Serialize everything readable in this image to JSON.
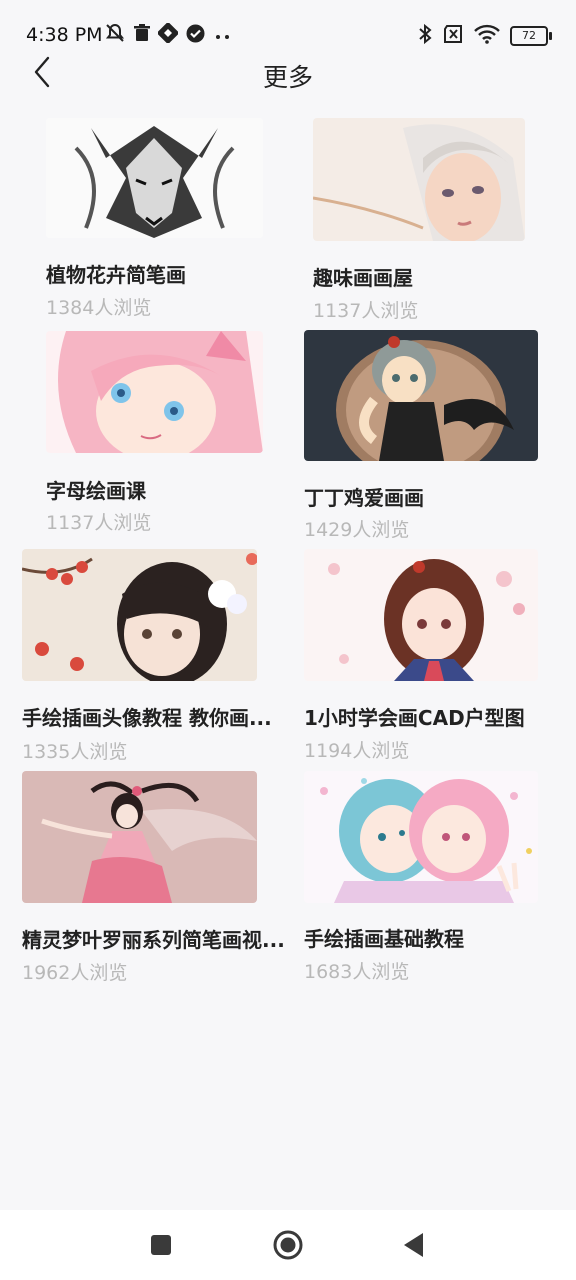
{
  "status_bar": {
    "time": "4:38 PM",
    "battery": "72",
    "left_icons": [
      "mute-bell-icon",
      "trash-icon",
      "app-icon",
      "check-circle-icon",
      "more-dots-icon"
    ],
    "right_icons": [
      "bluetooth-icon",
      "sim-off-icon",
      "wifi-icon",
      "battery-icon"
    ]
  },
  "header": {
    "title": "更多",
    "back_icon": "chevron-left-icon"
  },
  "courses": [
    {
      "title": "植物花卉简笔画",
      "views": "1384人浏览",
      "image": "wolf-line-art"
    },
    {
      "title": "趣味画画屋",
      "views": "1137人浏览",
      "image": "girl-sketch"
    },
    {
      "title": "字母绘画课",
      "views": "1137人浏览",
      "image": "pink-cat-girl"
    },
    {
      "title": "丁丁鸡爱画画",
      "views": "1429人浏览",
      "image": "bat-wing-girl"
    },
    {
      "title": "手绘插画头像教程 教你画...",
      "views": "1335人浏览",
      "image": "flower-hair-girl"
    },
    {
      "title": "1小时学会画CAD户型图",
      "views": "1194人浏览",
      "image": "kimono-girl"
    },
    {
      "title": "精灵梦叶罗丽系列简笔画视...",
      "views": "1962人浏览",
      "image": "pink-dress-girl"
    },
    {
      "title": "手绘插画基础教程",
      "views": "1683人浏览",
      "image": "two-girls"
    }
  ],
  "nav_bar": {
    "buttons": [
      "recents-square-icon",
      "home-circle-icon",
      "back-triangle-icon"
    ]
  }
}
